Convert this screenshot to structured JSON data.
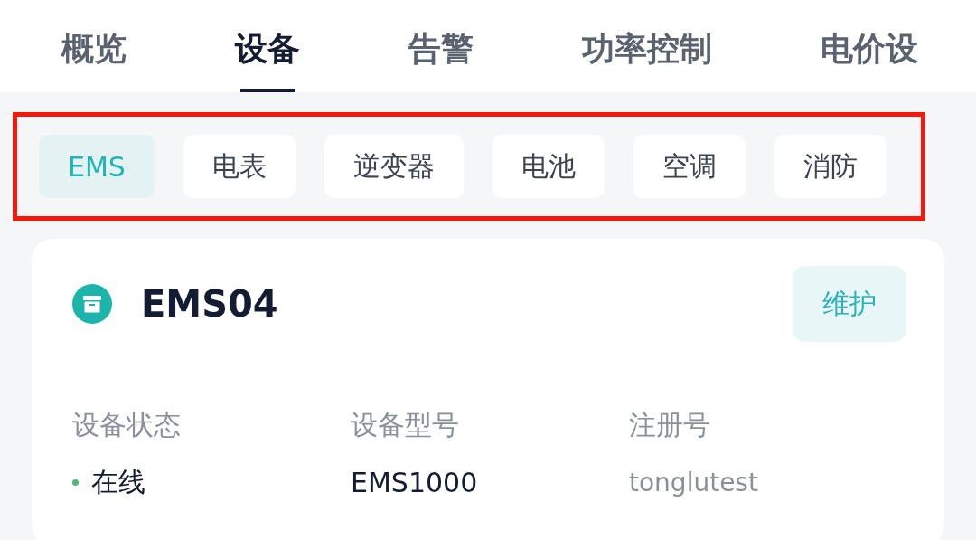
{
  "tabs": [
    {
      "label": "概览",
      "selected": false
    },
    {
      "label": "设备",
      "selected": true
    },
    {
      "label": "告警",
      "selected": false
    },
    {
      "label": "功率控制",
      "selected": false
    },
    {
      "label": "电价设",
      "selected": false
    }
  ],
  "device_types": [
    {
      "label": "EMS",
      "selected": true
    },
    {
      "label": "电表",
      "selected": false
    },
    {
      "label": "逆变器",
      "selected": false
    },
    {
      "label": "电池",
      "selected": false
    },
    {
      "label": "空调",
      "selected": false
    },
    {
      "label": "消防",
      "selected": false
    }
  ],
  "highlight": true,
  "device": {
    "name": "EMS04",
    "action": "维护",
    "fields": [
      {
        "label": "设备状态",
        "value": "在线",
        "kind": "status",
        "color": "#4fb878"
      },
      {
        "label": "设备型号",
        "value": "EMS1000",
        "kind": "text"
      },
      {
        "label": "注册号",
        "value": "tonglutest",
        "kind": "masked"
      }
    ]
  }
}
